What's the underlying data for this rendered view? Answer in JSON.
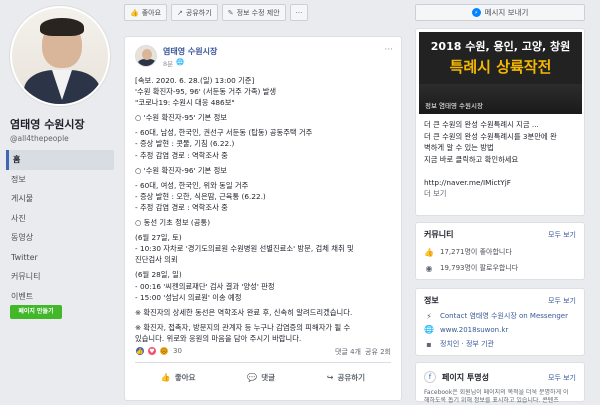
{
  "sidebar": {
    "page_name": "염태영 수원시장",
    "handle": "@all4thepeople",
    "nav": [
      "홈",
      "정보",
      "게시물",
      "사진",
      "동영상",
      "Twitter",
      "커뮤니티",
      "이벤트"
    ],
    "create_page": "페이지 만들기"
  },
  "top_actions": {
    "like": "좋아요",
    "share": "공유하기",
    "edit": "정보 수정 제안"
  },
  "post": {
    "author": "염태영 수원시장",
    "time": "8분",
    "lines": [
      "[속보. 2020. 6. 28.(일) 13:00 기준]",
      "'수원 확진자-95, 96' (서둔동 거주 가족) 발생",
      "\"코로나19: 수원시 대응 486보\"",
      "",
      "○ '수원 확진자-95' 기본 정보",
      "",
      "- 60대, 남성, 한국인, 권선구 서둔동 (탑동) 공동주택 거주",
      "- 증상 발현 : 콧물, 기침 (6.22.)",
      "- 추정 감염 경로 : 역학조사 중",
      "",
      "○ '수원 확진자-96' 기본 정보",
      "",
      "- 60대, 여성, 한국인, 위와 동일 거주",
      "- 증상 발현 : 오한, 식은땀, 근육통 (6.22.)",
      "- 추정 감염 경로 : 역학조사 중",
      "",
      "○ 동선 기초 정보 (공통)",
      "",
      "(6월 27일, 토)",
      "- 10:30 자차로 '경기도의료원 수원병원 선별진료소' 방문, 검체 채취 및",
      "  진단검사 의뢰",
      "",
      "(6월 28일, 일)",
      "- 00:16 '씨젠의료재단' 검사 결과 '양성' 판정",
      "- 15:00 '성남시 의료원' 이송 예정",
      "",
      "※ 확진자의 상세한 동선은 역학조사 완료 후, 신속히 알려드리겠습니다.",
      "",
      "※ 확진자, 접촉자, 방문지의 관계자 등 누구나 감염증의 피해자가 될 수",
      "  있습니다. 위로와 응원의 마음을 담아 주시기 바랍니다."
    ],
    "reaction_count": "30",
    "comments": "댓글 4개",
    "shares": "공유 2회",
    "like_label": "좋아요",
    "comment_label": "댓글",
    "share_label": "공유하기"
  },
  "right": {
    "message_button": "메시지 보내기",
    "banner_line1": "2018 수원, 용인, 고양, 창원",
    "banner_line2": "특례시 상륙작전",
    "banner_caption": "정보 염태영 수원시장",
    "ad_lines": [
      "더 큰 수원의 완성 수원특례시 지금 ...",
      "더 큰 수원의 완성 수원특례시를 3분만에 완",
      "벽하게 알 수 있는 방법",
      "지금 바로 클릭하고 확인하세요",
      "",
      "http://naver.me/IMictYjF",
      "더 보기"
    ],
    "community": {
      "title": "커뮤니티",
      "link": "모두 보기",
      "likes": "17,271명이 좋아합니다",
      "follows": "19,793명이 팔로우합니다"
    },
    "info": {
      "title": "정보",
      "link": "모두 보기",
      "messenger": "Contact 염태영 수원시장 on Messenger",
      "website": "www.2018suwon.kr",
      "category": "정치인 · 정부 기관"
    },
    "transparency": {
      "title": "페이지 투명성",
      "link": "모두 보기",
      "line1": "Facebook은 회원님이 페이지의 목적을 더욱 분명하게 이",
      "line2": "해하도록 돕기 위해 정보를 표시하고 있습니다. 콘텐츠"
    }
  },
  "colors": {
    "fb_blue": "#4267b2",
    "link": "#385898",
    "background": "#e9ebee",
    "banner_gold": "#f5b800",
    "create_green": "#42b72a"
  }
}
